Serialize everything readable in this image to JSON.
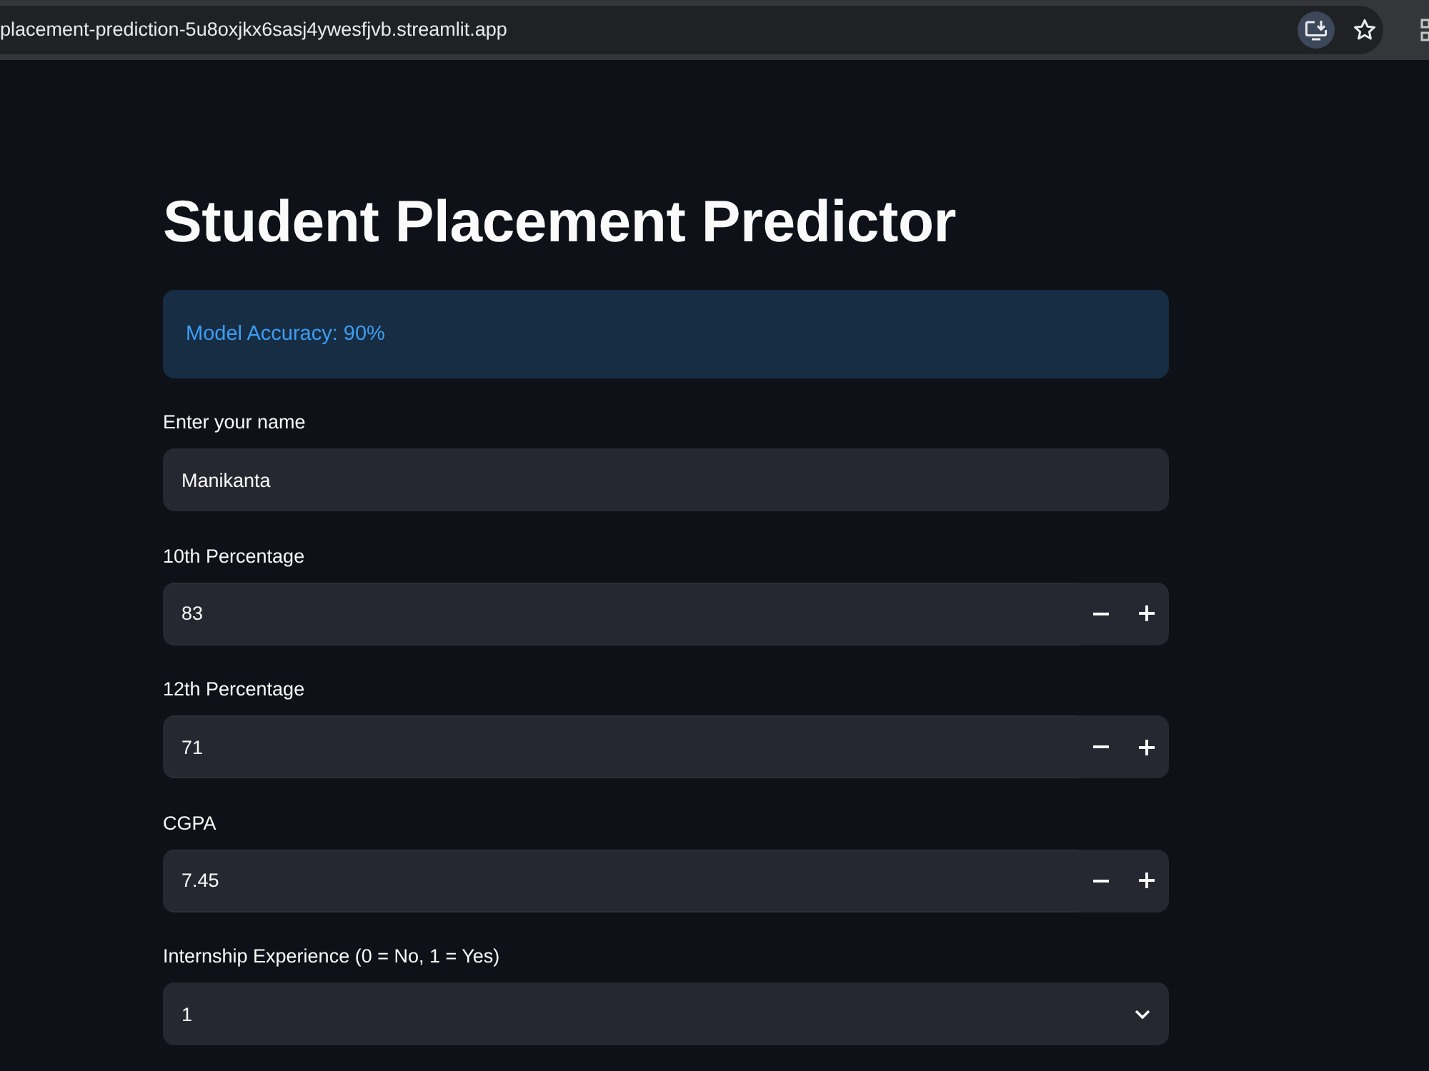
{
  "browser": {
    "url": "placement-prediction-5u8oxjkx6sasj4ywesfjvb.streamlit.app"
  },
  "page": {
    "title": "Student Placement Predictor",
    "alert": {
      "kind": "info",
      "text": "Model Accuracy: 90%"
    },
    "fields": [
      {
        "kind": "text",
        "label": "Enter your name",
        "value": "Manikanta"
      },
      {
        "kind": "number",
        "label": "10th Percentage",
        "value": "83"
      },
      {
        "kind": "number",
        "label": "12th Percentage",
        "value": "71"
      },
      {
        "kind": "number",
        "label": "CGPA",
        "value": "7.45"
      },
      {
        "kind": "select",
        "label": "Internship Experience (0 = No, 1 = Yes)",
        "value": "1"
      }
    ]
  }
}
